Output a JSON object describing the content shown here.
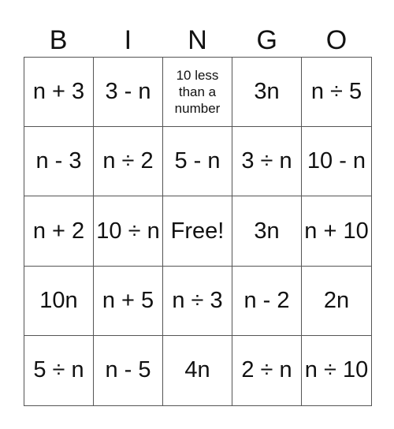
{
  "header": [
    "B",
    "I",
    "N",
    "G",
    "O"
  ],
  "cells": [
    [
      "n + 3",
      "3 - n",
      "10 less than a number",
      "3n",
      "n ÷ 5"
    ],
    [
      "n - 3",
      "n ÷ 2",
      "5 - n",
      "3 ÷ n",
      "10 - n"
    ],
    [
      "n + 2",
      "10 ÷ n",
      "Free!",
      "3n",
      "n + 10"
    ],
    [
      "10n",
      "n + 5",
      "n ÷ 3",
      "n - 2",
      "2n"
    ],
    [
      "5 ÷ n",
      "n - 5",
      "4n",
      "2 ÷ n",
      "n ÷ 10"
    ]
  ]
}
